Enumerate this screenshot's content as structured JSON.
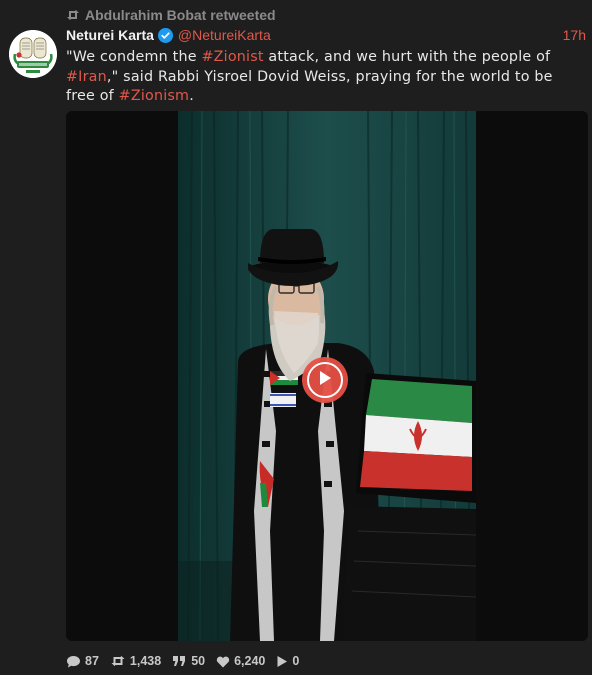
{
  "retweet": {
    "text": "Abdulrahim Bobat retweeted",
    "icon": "retweet-icon"
  },
  "tweet": {
    "author_name": "Neturei Karta",
    "author_handle": "@NetureiKarta",
    "verified": true,
    "time": "17h",
    "text_parts": [
      {
        "t": "\"We condemn the ",
        "tag": false
      },
      {
        "t": "#Zionist",
        "tag": true
      },
      {
        "t": " attack, and we hurt with the people of ",
        "tag": false
      },
      {
        "t": "#Iran",
        "tag": true
      },
      {
        "t": ",\" said Rabbi Yisroel Dovid Weiss, praying for the world to be free of ",
        "tag": false
      },
      {
        "t": "#Zionism",
        "tag": true
      },
      {
        "t": ".",
        "tag": false
      }
    ]
  },
  "media": {
    "type": "video",
    "play_icon": "play-icon"
  },
  "actions": {
    "replies": "87",
    "retweets": "1,438",
    "quotes": "50",
    "likes": "6,240",
    "views": "0"
  },
  "colors": {
    "accent": "#e0584b",
    "background": "#1e1e1e",
    "verified": "#1d9bf0"
  }
}
